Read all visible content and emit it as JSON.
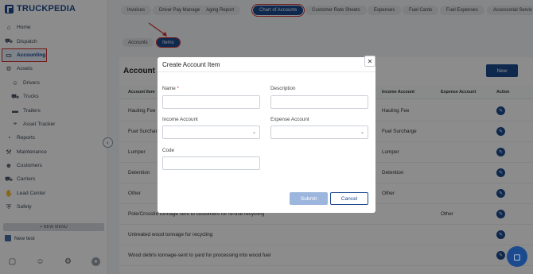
{
  "app": {
    "logo_text": "TRUCKPEDIA"
  },
  "sidebar": {
    "items": [
      {
        "label": "Home",
        "icon": "home-icon",
        "glyph": "⌂"
      },
      {
        "label": "Dispatch",
        "icon": "truck-icon",
        "glyph": "⛟"
      },
      {
        "label": "Accounting",
        "icon": "card-icon",
        "glyph": "▭"
      },
      {
        "label": "Assets",
        "icon": "assets-icon",
        "glyph": "⚙"
      },
      {
        "label": "Drivers",
        "icon": "drivers-icon",
        "glyph": "☺"
      },
      {
        "label": "Trucks",
        "icon": "truck-icon",
        "glyph": "⛟"
      },
      {
        "label": "Trailers",
        "icon": "trailer-icon",
        "glyph": "▬"
      },
      {
        "label": "Asset Tracker",
        "icon": "tracker-icon",
        "glyph": "⌖"
      },
      {
        "label": "Reports",
        "icon": "reports-icon",
        "glyph": "◔"
      },
      {
        "label": "Maintenance",
        "icon": "wrench-icon",
        "glyph": "⚒"
      },
      {
        "label": "Customers",
        "icon": "customers-icon",
        "glyph": "☻"
      },
      {
        "label": "Carriers",
        "icon": "carriers-icon",
        "glyph": "⛟"
      },
      {
        "label": "Lead Center",
        "icon": "handshake-icon",
        "glyph": "✋"
      },
      {
        "label": "Safety",
        "icon": "shield-icon",
        "glyph": "⛨"
      }
    ],
    "new_menu": "+ NEW MENU",
    "new_test": "New test"
  },
  "topbar": {
    "tabs": [
      "Invoices",
      "Driver Pay Manager",
      "Aging Report",
      "Chart of Accounts",
      "Customer Rate Sheets",
      "Expenses",
      "Fuel Cards",
      "Fuel Expenses",
      "Accessorial Servic"
    ]
  },
  "subtabs": {
    "accounts": "Accounts",
    "items": "Items"
  },
  "card": {
    "title": "Account",
    "new_button": "New",
    "columns": [
      "Account Item",
      "Income Account",
      "Expense Account",
      "Action"
    ],
    "rows": [
      {
        "name": "Hauling Fee",
        "income": "Hauling Fee",
        "expense": ""
      },
      {
        "name": "Fuel Surcharge",
        "income": "Fuel Surcharge",
        "expense": ""
      },
      {
        "name": "Lumper",
        "income": "Lumper",
        "expense": ""
      },
      {
        "name": "Detention",
        "income": "Detention",
        "expense": ""
      },
      {
        "name": "Other",
        "income": "Other",
        "expense": ""
      },
      {
        "name": "Pole/Crosstie tonnage sent to customers for re-use recycling",
        "income": "",
        "expense": "Other"
      },
      {
        "name": "Untreated wood tonnage for recycling",
        "income": "",
        "expense": ""
      },
      {
        "name": "Wood debris tonnage-sent to yard for processing into wood fuel",
        "income": "",
        "expense": ""
      }
    ]
  },
  "modal": {
    "title": "Create Account Item",
    "name_label": "Name",
    "required_mark": "*",
    "description_label": "Description",
    "income_label": "Income Account",
    "expense_label": "Expense Account",
    "code_label": "Code",
    "submit": "Submit",
    "cancel": "Cancel",
    "name_value": "",
    "description_value": "",
    "income_value": "",
    "expense_value": "",
    "code_value": ""
  },
  "colors": {
    "primary": "#1c4a8f",
    "highlight": "#d32f2f"
  }
}
